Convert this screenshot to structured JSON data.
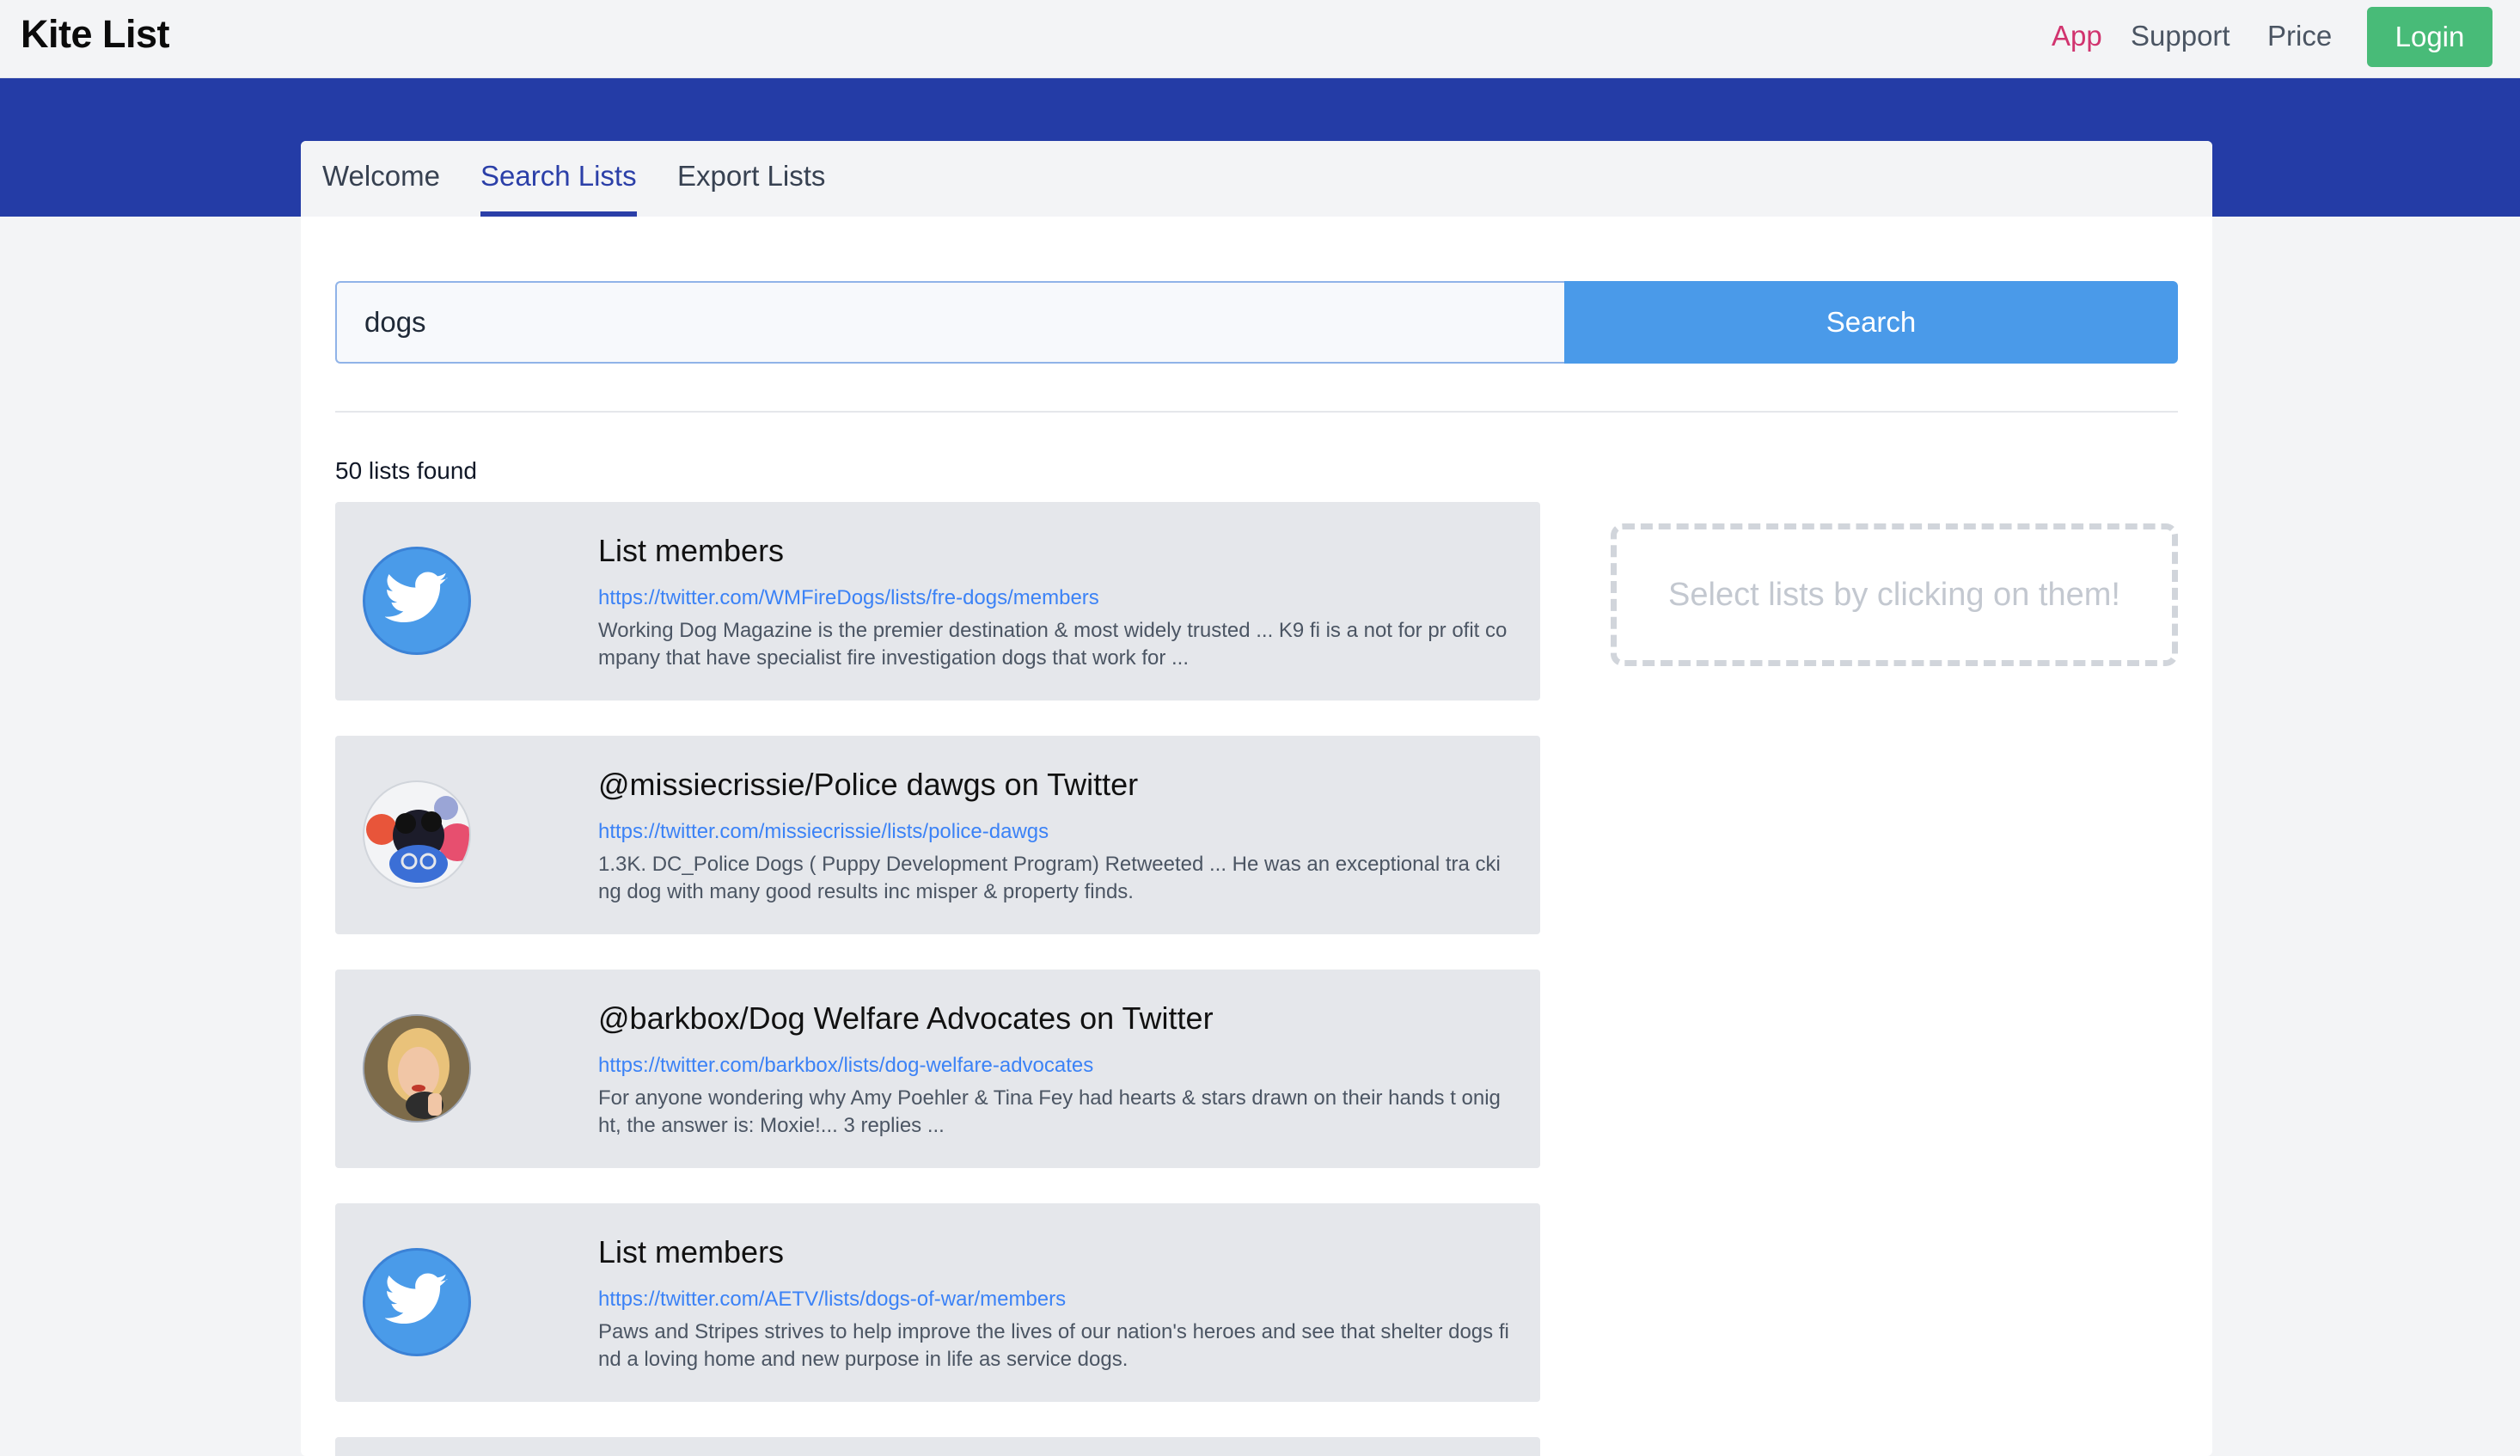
{
  "brand": "Kite List",
  "nav": {
    "app": "App",
    "support": "Support",
    "price": "Price",
    "login": "Login"
  },
  "tabs": {
    "welcome": "Welcome",
    "search": "Search Lists",
    "export": "Export Lists"
  },
  "search": {
    "value": "dogs",
    "button": "Search"
  },
  "results": {
    "count_text": "50 lists found",
    "items": [
      {
        "title": "List members",
        "url": "https://twitter.com/WMFireDogs/lists/fre-dogs/members",
        "desc": "Working Dog Magazine is the premier destination & most widely trusted ... K9 fi is a not for pr ofit company that have specialist fire investigation dogs that work for ..."
      },
      {
        "title": "@missiecrissie/Police dawgs on Twitter",
        "url": "https://twitter.com/missiecrissie/lists/police-dawgs",
        "desc": "1.3K. DC_Police Dogs ( Puppy Development Program) Retweeted ... He was an exceptional tra cking dog with many good results inc misper & property finds."
      },
      {
        "title": "@barkbox/Dog Welfare Advocates on Twitter",
        "url": "https://twitter.com/barkbox/lists/dog-welfare-advocates",
        "desc": "For anyone wondering why Amy Poehler & Tina Fey had hearts & stars drawn on their hands t onight, the answer is: Moxie!... 3 replies ..."
      },
      {
        "title": "List members",
        "url": "https://twitter.com/AETV/lists/dogs-of-war/members",
        "desc": "Paws and Stripes strives to help improve the lives of our nation's heroes and see that shelter dogs find a loving home and new purpose in life as service dogs."
      }
    ]
  },
  "dropzone": {
    "hint": "Select lists by clicking on them!"
  },
  "colors": {
    "band": "#243ca6",
    "active_tab": "#2b3fa8",
    "app_link": "#d1346f",
    "login": "#48bb78",
    "search_button": "#4a9ae9",
    "link": "#3b82f6"
  }
}
